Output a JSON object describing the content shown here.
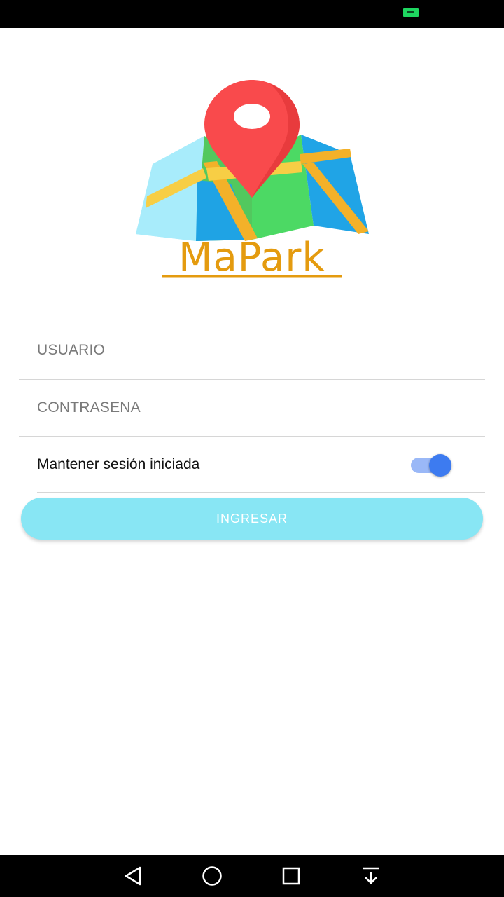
{
  "status_bar": {
    "battery_color": "#1ed760"
  },
  "logo": {
    "text": "MaPark",
    "text_color": "#e49b0f"
  },
  "form": {
    "username_placeholder": "USUARIO",
    "password_placeholder": "CONTRASENA",
    "remember_label": "Mantener sesión iniciada",
    "remember_enabled": true,
    "submit_label": "INGRESAR",
    "accent_color": "#3d7bf0",
    "button_color": "#88e6f4"
  },
  "nav_bar": {
    "buttons": [
      "back-icon",
      "home-icon",
      "recents-icon",
      "notification-pull-icon"
    ]
  }
}
